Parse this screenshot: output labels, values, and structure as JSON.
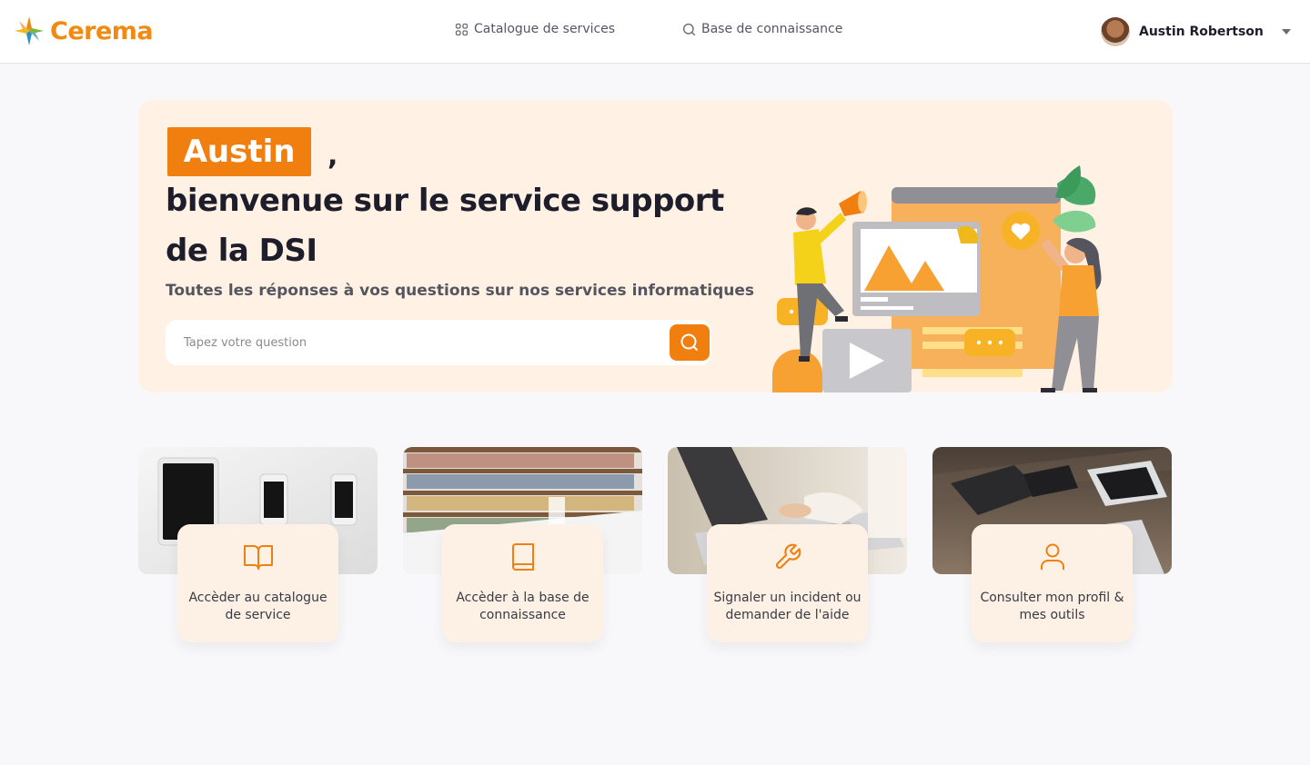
{
  "brand": {
    "name": "Cerema",
    "accent": "#f07f0f"
  },
  "nav": {
    "catalog": {
      "label": "Catalogue de services",
      "icon": "grid-icon"
    },
    "knowledge_base": {
      "label": "Base de connaissance",
      "icon": "search-icon"
    }
  },
  "user": {
    "name": "Austin Robertson",
    "icon": "chevron-down-icon"
  },
  "hero": {
    "first_name": "Austin",
    "comma": ",",
    "title": "bienvenue sur le service support de la DSI",
    "subtitle": "Toutes les réponses à vos questions sur nos services informatiques",
    "search_placeholder": "Tapez votre question"
  },
  "cards": [
    {
      "label": "Accèder au catalogue de service",
      "icon": "book-open-icon"
    },
    {
      "label": "Accèder à la base de connaissance",
      "icon": "book-icon"
    },
    {
      "label": "Signaler un incident ou demander de l'aide",
      "icon": "wrench-icon"
    },
    {
      "label": "Consulter mon profil & mes outils",
      "icon": "user-icon"
    }
  ]
}
